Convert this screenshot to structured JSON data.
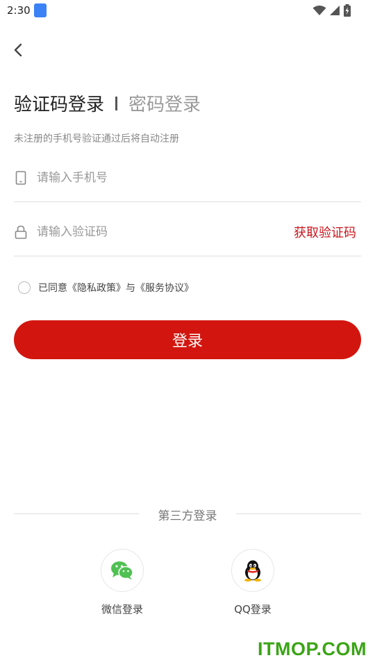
{
  "status_bar": {
    "time": "2:30"
  },
  "title": {
    "active_tab": "验证码登录",
    "inactive_tab": "密码登录"
  },
  "subtitle": "未注册的手机号验证通过后将自动注册",
  "phone_field": {
    "placeholder": "请输入手机号",
    "value": ""
  },
  "code_field": {
    "placeholder": "请输入验证码",
    "value": "",
    "get_code_label": "获取验证码"
  },
  "agreement": {
    "text": "已同意《隐私政策》与《服务协议》",
    "checked": false
  },
  "login_button": "登录",
  "third_party": {
    "label": "第三方登录",
    "options": [
      {
        "label": "微信登录",
        "icon": "wechat-icon"
      },
      {
        "label": "QQ登录",
        "icon": "qq-icon"
      }
    ]
  },
  "watermark": "ITMOP.COM",
  "colors": {
    "accent": "#d2160f",
    "link": "#c8161d",
    "watermark": "#3aa515",
    "wechat": "#4fc152"
  }
}
